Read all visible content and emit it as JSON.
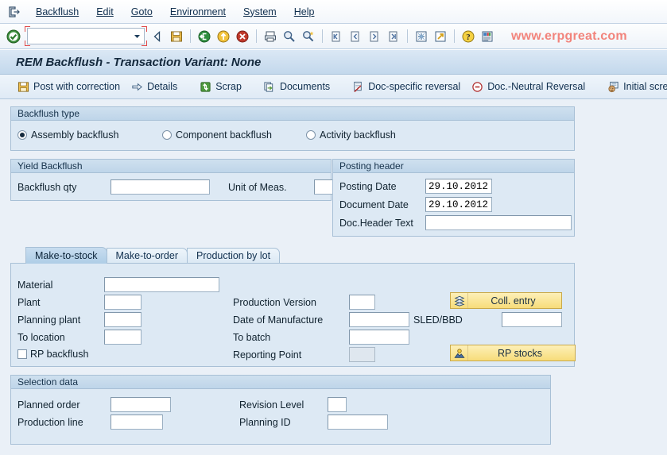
{
  "menu": {
    "system_icon": "exit-door-icon",
    "items": [
      {
        "label": "Backflush",
        "accel": "B"
      },
      {
        "label": "Edit",
        "accel": "E"
      },
      {
        "label": "Goto",
        "accel": "G"
      },
      {
        "label": "Environment",
        "accel": "E"
      },
      {
        "label": "System",
        "accel": "y"
      },
      {
        "label": "Help",
        "accel": "H"
      }
    ]
  },
  "toolbar": {
    "enter_icon": "green-check-icon",
    "command_value": "",
    "command_placeholder": "",
    "dropdown_icon": "chevron-down-icon",
    "buttons": [
      {
        "name": "back-icon"
      },
      {
        "name": "save-icon"
      },
      {
        "name": "exit-icon"
      },
      {
        "name": "back-up-icon"
      },
      {
        "name": "cancel-icon"
      },
      {
        "name": "print-icon"
      },
      {
        "name": "find-icon"
      },
      {
        "name": "find-next-icon"
      },
      {
        "name": "first-page-icon"
      },
      {
        "name": "previous-page-icon"
      },
      {
        "name": "next-page-icon"
      },
      {
        "name": "last-page-icon"
      },
      {
        "name": "create-session-icon"
      },
      {
        "name": "create-shortcut-icon"
      },
      {
        "name": "help-icon"
      },
      {
        "name": "layout-menu-icon"
      }
    ],
    "watermark": "www.erpgreat.com"
  },
  "title": "REM Backflush - Transaction Variant: None",
  "app_toolbar": {
    "buttons": [
      {
        "label": "Post with correction",
        "icon": "save-icon"
      },
      {
        "label": "Details",
        "icon": "details-arrow-icon"
      },
      {
        "label": "Scrap",
        "icon": "recycle-icon"
      },
      {
        "label": "Documents",
        "icon": "documents-icon"
      },
      {
        "label": "Doc-specific reversal",
        "icon": "doc-reversal-icon"
      },
      {
        "label": "Doc.-Neutral Reversal",
        "icon": "minus-circle-icon"
      },
      {
        "label": "Initial screen",
        "icon": "initial-screen-icon"
      }
    ]
  },
  "backflush_type": {
    "group_title": "Backflush type",
    "options": [
      {
        "label": "Assembly backflush",
        "selected": true
      },
      {
        "label": "Component backflush",
        "selected": false
      },
      {
        "label": "Activity backflush",
        "selected": false
      }
    ]
  },
  "yield_backflush": {
    "group_title": "Yield Backflush",
    "qty_label": "Backflush qty",
    "qty_value": "",
    "uom_label": "Unit of Meas.",
    "uom_value": ""
  },
  "posting_header": {
    "group_title": "Posting header",
    "posting_date_label": "Posting Date",
    "posting_date_value": "29.10.2012",
    "document_date_label": "Document Date",
    "document_date_value": "29.10.2012",
    "header_text_label": "Doc.Header Text",
    "header_text_value": ""
  },
  "tabs": [
    {
      "label": "Make-to-stock",
      "active": true
    },
    {
      "label": "Make-to-order",
      "active": false
    },
    {
      "label": "Production by lot",
      "active": false
    }
  ],
  "make_to_stock": {
    "material_label": "Material",
    "material_value": "",
    "plant_label": "Plant",
    "plant_value": "",
    "planning_plant_label": "Planning plant",
    "planning_plant_value": "",
    "to_location_label": "To location",
    "to_location_value": "",
    "rp_backflush_label": "RP backflush",
    "rp_backflush_checked": false,
    "production_version_label": "Production Version",
    "production_version_value": "",
    "date_of_manufacture_label": "Date of Manufacture",
    "date_of_manufacture_value": "",
    "to_batch_label": "To batch",
    "to_batch_value": "",
    "reporting_point_label": "Reporting Point",
    "reporting_point_value": "",
    "sled_label": "SLED/BBD",
    "sled_value": "",
    "coll_entry_label": "Coll. entry",
    "coll_entry_icon": "stack-icon",
    "rp_stocks_label": "RP stocks",
    "rp_stocks_icon": "rp-stocks-icon"
  },
  "selection_data": {
    "group_title": "Selection data",
    "planned_order_label": "Planned order",
    "planned_order_value": "",
    "production_line_label": "Production line",
    "production_line_value": "",
    "revision_level_label": "Revision Level",
    "revision_level_value": "",
    "planning_id_label": "Planning ID",
    "planning_id_value": ""
  },
  "colors": {
    "accent": "#14293d",
    "panel": "#dde9f4",
    "background": "#eaf0f7",
    "watermark": "#f2847c",
    "button_yellow": "#f7dc7a"
  }
}
